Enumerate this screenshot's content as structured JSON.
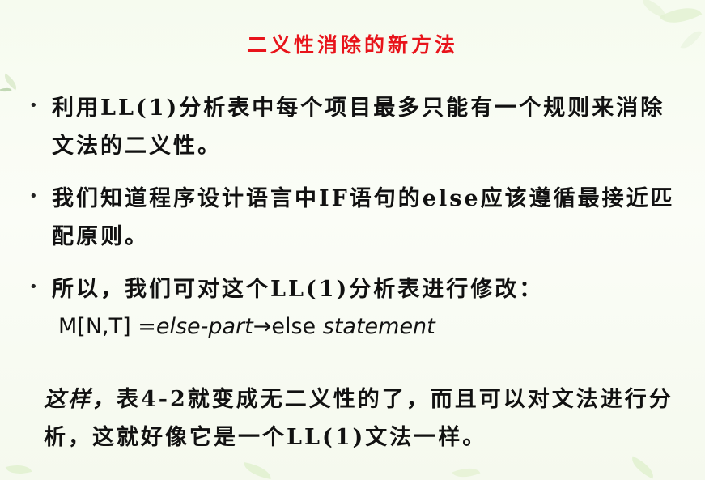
{
  "slide": {
    "title": "二义性消除的新方法",
    "bullets": [
      {
        "marker": "•",
        "text": "利用LL(1)分析表中每个项目最多只能有一个规则来消除文法的二义性。"
      },
      {
        "marker": "•",
        "text": "我们知道程序设计语言中IF语句的else应该遵循最接近匹配原则。"
      },
      {
        "marker": "•",
        "text": "所以，我们可对这个LL(1)分析表进行修改："
      }
    ],
    "formula": {
      "lhs": "M[N,T] ",
      "eq_part": "=else-part",
      "arrow": "→",
      "keyword": "else ",
      "statement": "statement"
    },
    "closing": {
      "lead": "这样，",
      "text": "表4-2就变成无二义性的了，而且可以对文法进行分析，这就好像它是一个LL(1)文法一样。"
    },
    "colors": {
      "title": "#e8141b",
      "text": "#111111",
      "background": "#f6fbef"
    }
  }
}
